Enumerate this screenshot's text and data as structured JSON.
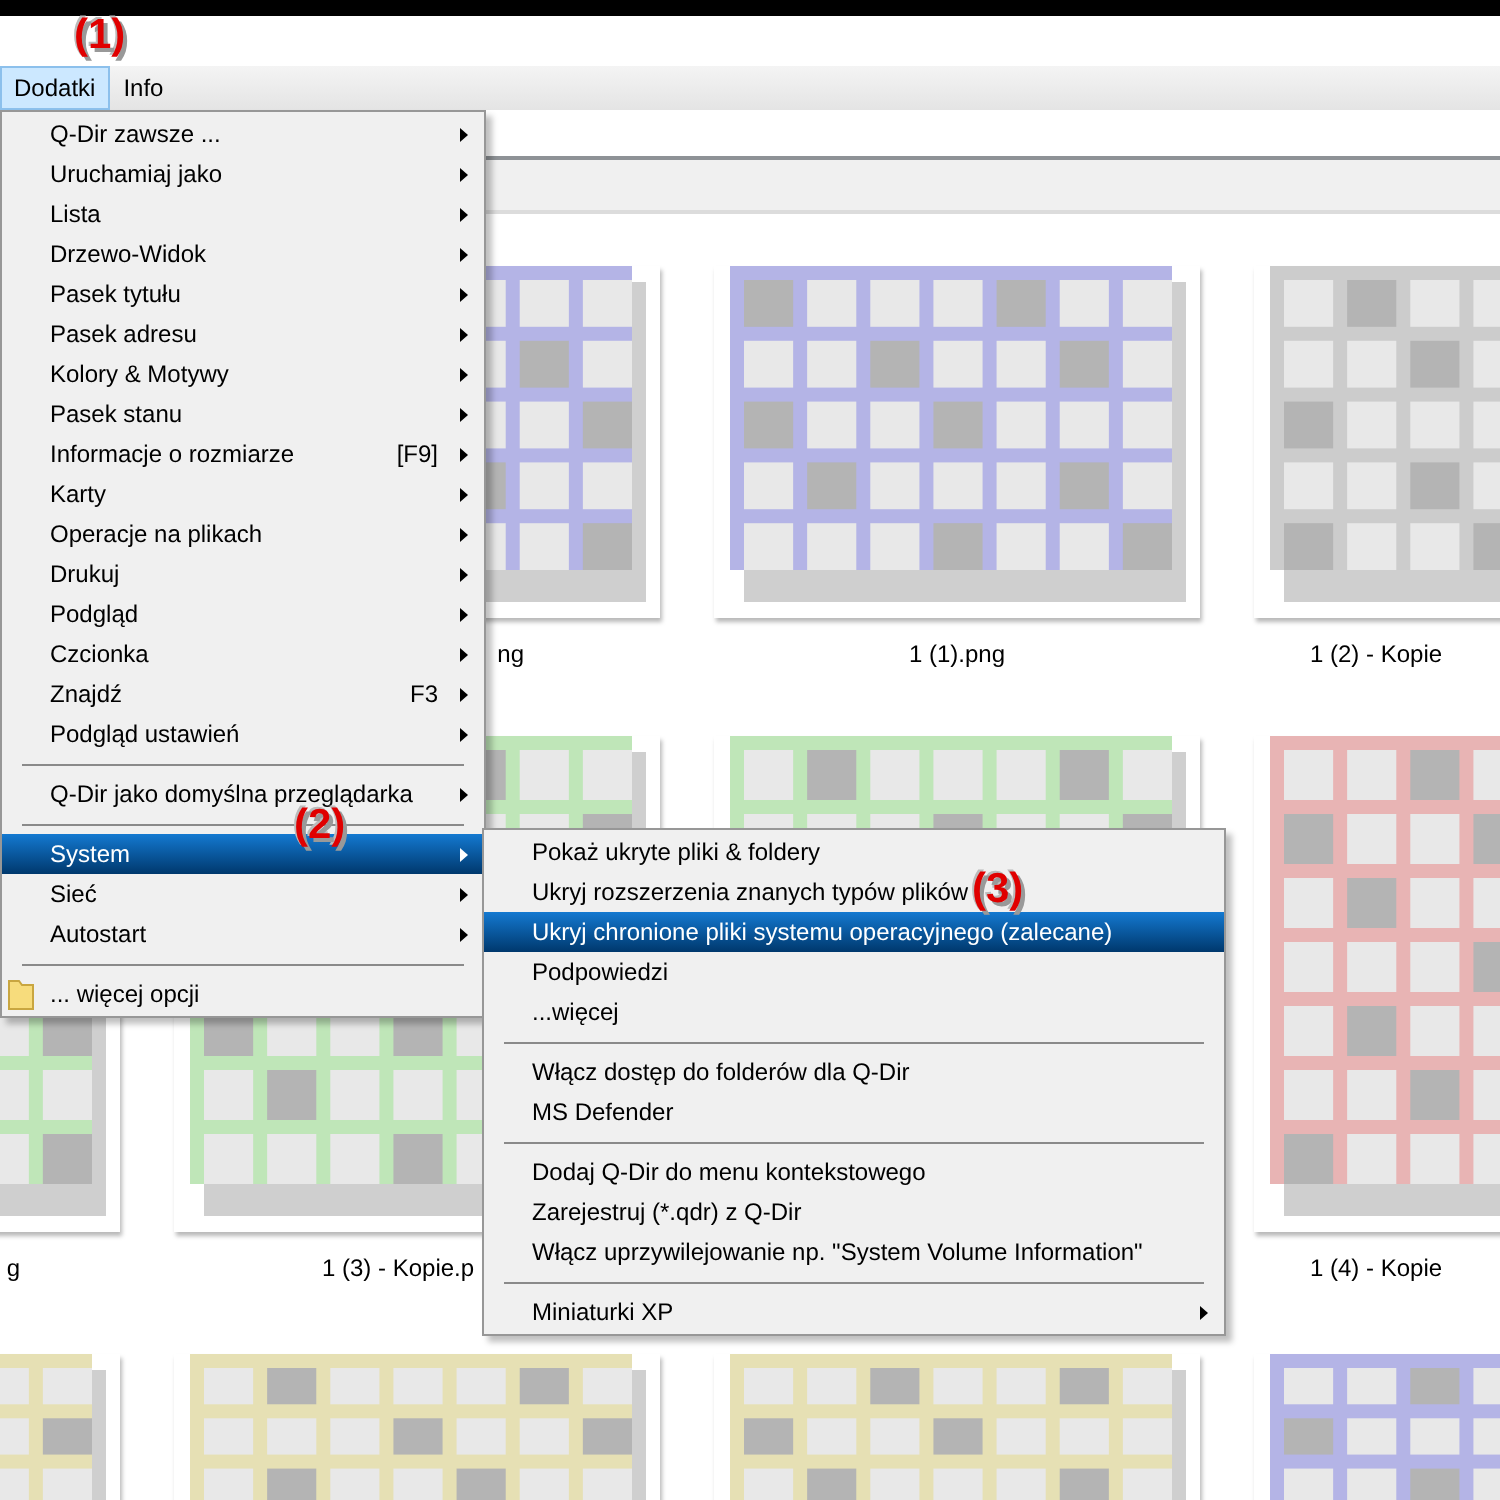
{
  "callouts": [
    "(1)",
    "(2)",
    "(3)"
  ],
  "menu_bar": [
    {
      "label": "Dodatki",
      "selected": true
    },
    {
      "label": "Info",
      "selected": false
    }
  ],
  "main_menu": [
    {
      "kind": "item",
      "label": "Q-Dir zawsze ...",
      "submenu": true,
      "selected": false
    },
    {
      "kind": "item",
      "label": "Uruchamiaj jako",
      "submenu": true,
      "selected": false
    },
    {
      "kind": "item",
      "label": "Lista",
      "submenu": true,
      "selected": false
    },
    {
      "kind": "item",
      "label": "Drzewo-Widok",
      "submenu": true,
      "selected": false
    },
    {
      "kind": "item",
      "label": "Pasek tytułu",
      "submenu": true,
      "selected": false
    },
    {
      "kind": "item",
      "label": "Pasek adresu",
      "submenu": true,
      "selected": false
    },
    {
      "kind": "item",
      "label": "Kolory & Motywy",
      "submenu": true,
      "selected": false
    },
    {
      "kind": "item",
      "label": "Pasek stanu",
      "submenu": true,
      "selected": false
    },
    {
      "kind": "item",
      "label": "Informacje o rozmiarze",
      "shortcut": "[F9]",
      "submenu": true,
      "selected": false
    },
    {
      "kind": "item",
      "label": "Karty",
      "submenu": true,
      "selected": false
    },
    {
      "kind": "item",
      "label": "Operacje na plikach",
      "submenu": true,
      "selected": false
    },
    {
      "kind": "item",
      "label": "Drukuj",
      "submenu": true,
      "selected": false
    },
    {
      "kind": "item",
      "label": "Podgląd",
      "submenu": true,
      "selected": false
    },
    {
      "kind": "item",
      "label": "Czcionka",
      "submenu": true,
      "selected": false
    },
    {
      "kind": "item",
      "label": "Znajdź",
      "shortcut": "F3",
      "submenu": true,
      "selected": false
    },
    {
      "kind": "item",
      "label": "Podgląd ustawień",
      "submenu": true,
      "selected": false
    },
    {
      "kind": "separator"
    },
    {
      "kind": "item",
      "label": "Q-Dir jako domyślna przeglądarka",
      "submenu": true,
      "selected": false
    },
    {
      "kind": "separator"
    },
    {
      "kind": "item",
      "label": "System",
      "submenu": true,
      "selected": true
    },
    {
      "kind": "item",
      "label": "Sieć",
      "submenu": true,
      "selected": false
    },
    {
      "kind": "item",
      "label": "Autostart",
      "submenu": true,
      "selected": false
    },
    {
      "kind": "separator"
    },
    {
      "kind": "folder-item",
      "label": "... więcej opcji",
      "submenu": false,
      "selected": false
    }
  ],
  "system_submenu": [
    {
      "kind": "item",
      "label": "Pokaż ukryte pliki & foldery",
      "submenu": false,
      "selected": false
    },
    {
      "kind": "item",
      "label": "Ukryj rozszerzenia znanych typów plików",
      "submenu": false,
      "selected": false
    },
    {
      "kind": "item",
      "label": "Ukryj chronione pliki systemu operacyjnego (zalecane)",
      "submenu": false,
      "selected": true
    },
    {
      "kind": "item",
      "label": "Podpowiedzi",
      "submenu": false,
      "selected": false
    },
    {
      "kind": "item",
      "label": "...więcej",
      "submenu": false,
      "selected": false
    },
    {
      "kind": "separator"
    },
    {
      "kind": "item",
      "label": "Włącz dostęp do folderów dla Q-Dir",
      "submenu": false,
      "selected": false
    },
    {
      "kind": "item",
      "label": "MS Defender",
      "submenu": false,
      "selected": false
    },
    {
      "kind": "separator"
    },
    {
      "kind": "item",
      "label": "Dodaj Q-Dir do menu kontekstowego",
      "submenu": false,
      "selected": false
    },
    {
      "kind": "item",
      "label": "Zarejestruj (*.qdr) z Q-Dir",
      "submenu": false,
      "selected": false
    },
    {
      "kind": "item",
      "label": "Włącz uprzywilejowanie np. \"System Volume Information\"",
      "submenu": false,
      "selected": false
    },
    {
      "kind": "separator"
    },
    {
      "kind": "item",
      "label": "Miniaturki XP",
      "submenu": true,
      "selected": false
    }
  ],
  "thumbnail_rows": [
    {
      "cells": [
        {
          "color": "#b4b4e6",
          "label": "ng"
        },
        {
          "color": "#b4b4e6",
          "label": "1 (1).png"
        },
        {
          "color": "#cccccc",
          "label": "1 (2) - Kopie"
        }
      ]
    },
    {
      "cells": [
        {
          "color": "#bfe6b8",
          "label": "g"
        },
        {
          "color": "#bfe6b8",
          "label": "1 (3) - Kopie.p"
        },
        {
          "color": "#bfe6b8"
        },
        {
          "color": "#e8b4b4",
          "label": "1 (4) - Kopie"
        }
      ]
    },
    {
      "cells": [
        {
          "color": "#e6e0b4"
        },
        {
          "color": "#e6e0b4"
        },
        {
          "color": "#e6e0b4"
        },
        {
          "color": "#b4b4e6"
        }
      ]
    }
  ]
}
